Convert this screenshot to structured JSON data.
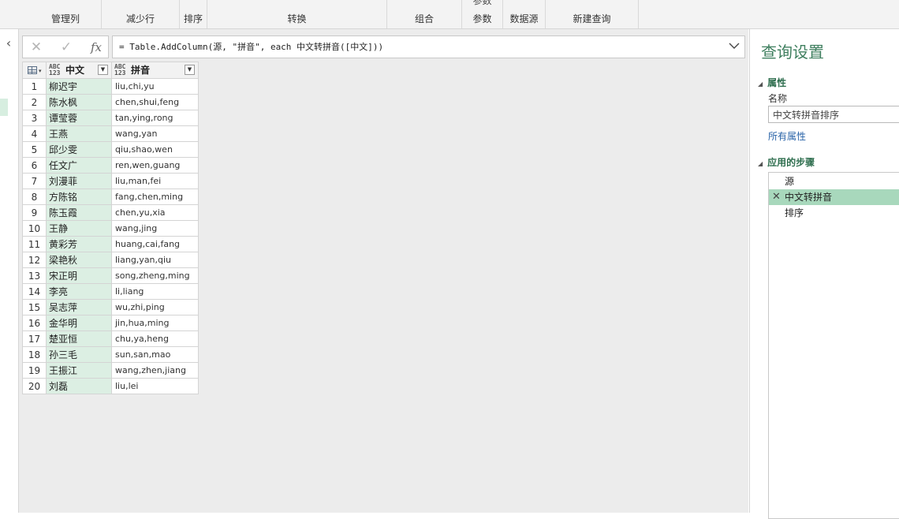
{
  "ribbon": {
    "groups": [
      {
        "label": "管理列",
        "top": ""
      },
      {
        "label": "减少行",
        "top": ""
      },
      {
        "label": "排序",
        "top": ""
      },
      {
        "label": "转换",
        "top": ""
      },
      {
        "label": "组合",
        "top": ""
      },
      {
        "label": "参数",
        "top": "参数"
      },
      {
        "label": "数据源",
        "top": ""
      },
      {
        "label": "新建查询",
        "top": ""
      }
    ]
  },
  "formula": {
    "cancel_icon": "✕",
    "commit_icon": "✓",
    "fx_label": "fx",
    "text": "= Table.AddColumn(源, \"拼音\", each 中文转拼音([中文]))"
  },
  "table": {
    "columns": [
      {
        "type_badge": "ABC\n123",
        "name": "中文"
      },
      {
        "type_badge": "ABC\n123",
        "name": "拼音"
      }
    ],
    "rows": [
      {
        "num": "1",
        "zh": "柳迟宇",
        "py": "liu,chi,yu"
      },
      {
        "num": "2",
        "zh": "陈水枫",
        "py": "chen,shui,feng"
      },
      {
        "num": "3",
        "zh": "谭莹蓉",
        "py": "tan,ying,rong"
      },
      {
        "num": "4",
        "zh": "王燕",
        "py": "wang,yan"
      },
      {
        "num": "5",
        "zh": "邱少雯",
        "py": "qiu,shao,wen"
      },
      {
        "num": "6",
        "zh": "任文广",
        "py": "ren,wen,guang"
      },
      {
        "num": "7",
        "zh": "刘漫菲",
        "py": "liu,man,fei"
      },
      {
        "num": "8",
        "zh": "方陈铭",
        "py": "fang,chen,ming"
      },
      {
        "num": "9",
        "zh": "陈玉霞",
        "py": "chen,yu,xia"
      },
      {
        "num": "10",
        "zh": "王静",
        "py": "wang,jing"
      },
      {
        "num": "11",
        "zh": "黄彩芳",
        "py": "huang,cai,fang"
      },
      {
        "num": "12",
        "zh": "梁艳秋",
        "py": "liang,yan,qiu"
      },
      {
        "num": "13",
        "zh": "宋正明",
        "py": "song,zheng,ming"
      },
      {
        "num": "14",
        "zh": "李亮",
        "py": "li,liang"
      },
      {
        "num": "15",
        "zh": "吴志萍",
        "py": "wu,zhi,ping"
      },
      {
        "num": "16",
        "zh": "金华明",
        "py": "jin,hua,ming"
      },
      {
        "num": "17",
        "zh": "楚亚恒",
        "py": "chu,ya,heng"
      },
      {
        "num": "18",
        "zh": "孙三毛",
        "py": "sun,san,mao"
      },
      {
        "num": "19",
        "zh": "王振江",
        "py": "wang,zhen,jiang"
      },
      {
        "num": "20",
        "zh": "刘磊",
        "py": "liu,lei"
      }
    ]
  },
  "query_settings": {
    "title": "查询设置",
    "properties_heading": "属性",
    "name_label": "名称",
    "name_value": "中文转拼音排序",
    "all_properties_link": "所有属性",
    "steps_heading": "应用的步骤",
    "steps": [
      {
        "label": "源",
        "selected": false
      },
      {
        "label": "中文转拼音",
        "selected": true
      },
      {
        "label": "排序",
        "selected": false
      }
    ],
    "delete_icon": "✕"
  },
  "colors": {
    "accent_green": "#3f7f5f",
    "selected_step": "#a8d8bc",
    "zh_column_fill": "#dcefe3",
    "link_blue": "#2a64a8"
  }
}
